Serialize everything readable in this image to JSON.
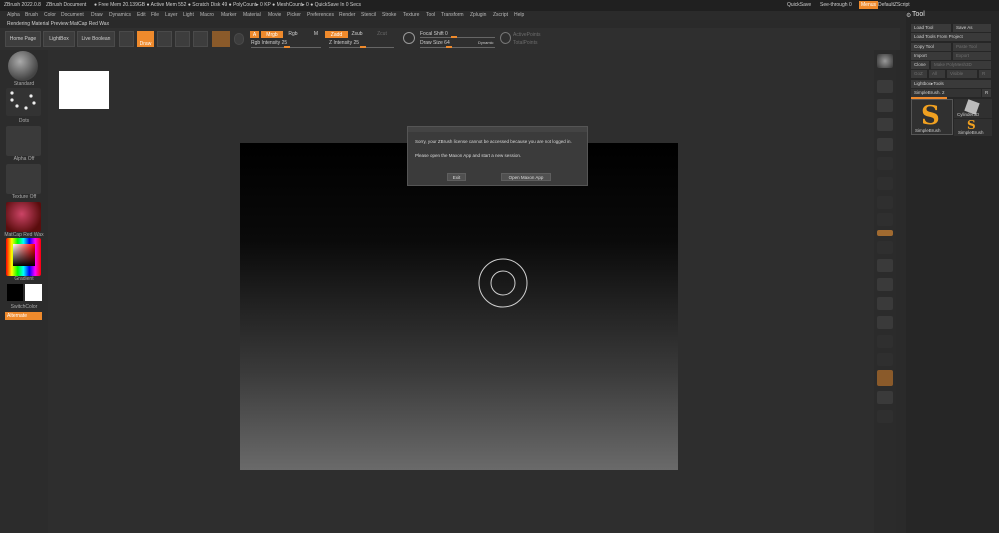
{
  "titlebar": {
    "app": "ZBrush 2022.0.8",
    "doc": "ZBrush Document",
    "stats": "● Free Mem 20.139GB ● Active Mem 552 ● Scratch Disk 49 ● PolyCount▸ 0 KP ● MeshCount▸ 0 ● QuickSave In 0 Secs",
    "quicksave": "QuickSave",
    "see_through": "See-through",
    "see_through_val": "0",
    "menus": "Menus",
    "script": "DefaultZScript"
  },
  "menubar": [
    "Alpha",
    "Brush",
    "Color",
    "Document",
    "Draw",
    "Dynamics",
    "Edit",
    "File",
    "Layer",
    "Light",
    "Macro",
    "Marker",
    "Material",
    "Movie",
    "Picker",
    "Preferences",
    "Render",
    "Stencil",
    "Stroke",
    "Texture",
    "Tool",
    "Transform",
    "Zplugin",
    "Zscript",
    "Help"
  ],
  "infobar": "Rendering Material Preview:MatCap Red Wax",
  "shelf": {
    "home": "Home Page",
    "lightbox": "LightBox",
    "live_boolean": "Live Boolean",
    "draw": "Draw",
    "a": "A",
    "mrgb": "Mrgb",
    "rgb": "Rgb",
    "m": "M",
    "rgb_intensity": "Rgb Intensity 25",
    "zadd": "Zadd",
    "zsub": "Zsub",
    "zcut": "Zcut",
    "z_intensity": "Z Intensity 25",
    "focal_shift": "Focal Shift 0",
    "draw_size": "Draw Size 64",
    "dynamic": "Dynamic",
    "active_points": "ActivePoints",
    "total_points": "TotalPoints"
  },
  "leftpanel": {
    "brush_label": "Standard",
    "dots_label": "Dots",
    "alpha_label": "Alpha Off",
    "texture_label": "Texture Off",
    "material_label": "MatCap Red Wax",
    "gradient_label": "Gradient",
    "switch_label": "SwitchColor",
    "alternate_label": "Alternate"
  },
  "dialog": {
    "line1": "Sorry, your ZBrush license cannot be accessed because you are not logged in.",
    "line2": "Please open the Maxon App and start a new session.",
    "exit": "Exit",
    "open": "Open Maxon App"
  },
  "tool": {
    "title": "Tool",
    "load_tool": "Load Tool",
    "save_as": "Save As",
    "load_from_project": "Load Tools From Project",
    "copy_tool": "Copy Tool",
    "paste_tool": "Paste Tool",
    "import": "Import",
    "export": "Export",
    "clone": "Clone",
    "make_polymesh": "Make PolyMesh3D",
    "goz": "GoZ",
    "all": "All",
    "visible": "Visible",
    "r": "R",
    "lightbox_tools": "Lightbox▸Tools",
    "simplebrush_count": "SimpleBrush. 2",
    "r2": "R",
    "thumb1": "SimpleBrush",
    "thumb2": "Cylinder3D",
    "thumb3": "SimpleBrush"
  },
  "colors": {
    "accent": "#ef8a2c",
    "canvas": "#2e2e2e"
  }
}
